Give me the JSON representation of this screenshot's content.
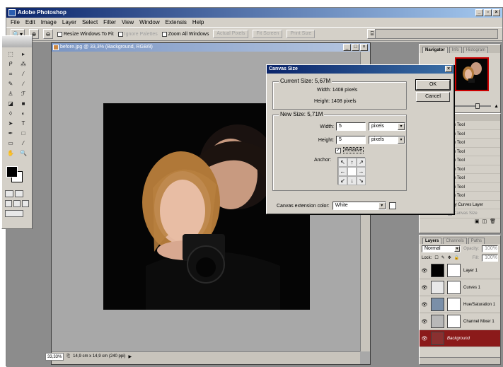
{
  "app": {
    "title": "Adobe Photoshop"
  },
  "menu": [
    "File",
    "Edit",
    "Image",
    "Layer",
    "Select",
    "Filter",
    "View",
    "Window",
    "Extensis",
    "Help"
  ],
  "options_bar": {
    "resize_windows": "Resize Windows To Fit",
    "ignore_palettes": "Ignore Palettes",
    "zoom_all_windows": "Zoom All Windows",
    "actual_pixels": "Actual Pixels",
    "fit_screen": "Fit Screen",
    "print_size": "Print Size"
  },
  "document": {
    "title": "before.jpg @ 33,3% (Background, RGB/8)",
    "zoom": "33,33%",
    "info": "14,9 cm x 14,9 cm (240 ppi)"
  },
  "dialog": {
    "title": "Canvas Size",
    "current_size_label": "Current Size: 5,67M",
    "current_width": "Width: 1408 pixels",
    "current_height": "Height: 1408 pixels",
    "new_size_label": "New Size: 5,71M",
    "width_label": "Width:",
    "width_value": "5",
    "width_unit": "pixels",
    "height_label": "Height:",
    "height_value": "5",
    "height_unit": "pixels",
    "relative_label": "Relative",
    "relative_checked": true,
    "anchor_label": "Anchor:",
    "anchor_arrows": [
      "↖",
      "↑",
      "↗",
      "←",
      "",
      "→",
      "↙",
      "↓",
      "↘"
    ],
    "extension_color_label": "Canvas extension color:",
    "extension_color_value": "White",
    "ok": "OK",
    "cancel": "Cancel"
  },
  "navigator": {
    "tabs": [
      "Navigator",
      "Info",
      "Histogram"
    ]
  },
  "history": {
    "items": [
      "n Tool",
      "n Tool",
      "n Tool",
      "n Tool",
      "n Tool",
      "n Tool",
      "n Tool",
      "n Tool",
      "n Tool",
      "fy Curves Layer"
    ],
    "footer": "Canvas Size"
  },
  "layers": {
    "tabs": [
      "Layers",
      "Channels",
      "Paths"
    ],
    "blend_mode": "Normal",
    "opacity_label": "Opacity:",
    "opacity_value": "100%",
    "lock_label": "Lock:",
    "fill_label": "Fill:",
    "fill_value": "100%",
    "rows": [
      {
        "name": "Layer 1",
        "thumb": "#000000",
        "selected": false
      },
      {
        "name": "Curves 1",
        "thumb": "#e8e8e8",
        "selected": false
      },
      {
        "name": "Hue/Saturation 1",
        "thumb": "#7a8fa8",
        "selected": false
      },
      {
        "name": "Channel Mixer 1",
        "thumb": "#b8b8b8",
        "selected": false
      },
      {
        "name": "Background",
        "thumb": "#8a3030",
        "selected": true
      }
    ]
  },
  "colors": {
    "accent": "#0a246a",
    "selected_layer": "#8b1a1a"
  }
}
